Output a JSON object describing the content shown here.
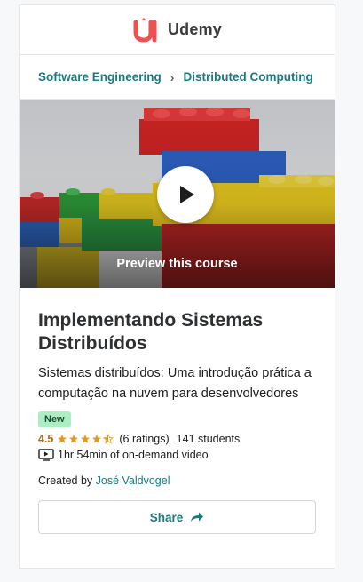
{
  "brand": {
    "name": "Udemy",
    "mark_color": "#ec5252"
  },
  "breadcrumb": {
    "items": [
      "Software Engineering",
      "Distributed Computing"
    ],
    "separator": "›"
  },
  "preview": {
    "label": "Preview this course"
  },
  "course": {
    "title": "Implementando Sistemas Distribuídos",
    "subtitle": "Sistemas distribuídos: Uma introdução prática a computação na nuvem para desenvolvedores",
    "badge": "New",
    "rating": "4.5",
    "rating_value": 4.5,
    "ratings_count": "(6 ratings)",
    "students": "141 students",
    "video": "1hr 54min of on-demand video",
    "created_by_label": "Created by",
    "author": "José Valdvogel"
  },
  "actions": {
    "share_label": "Share"
  },
  "colors": {
    "accent": "#1b7a80",
    "star": "#e59819",
    "rating_text": "#b4690e",
    "badge_bg": "#aceec4"
  }
}
